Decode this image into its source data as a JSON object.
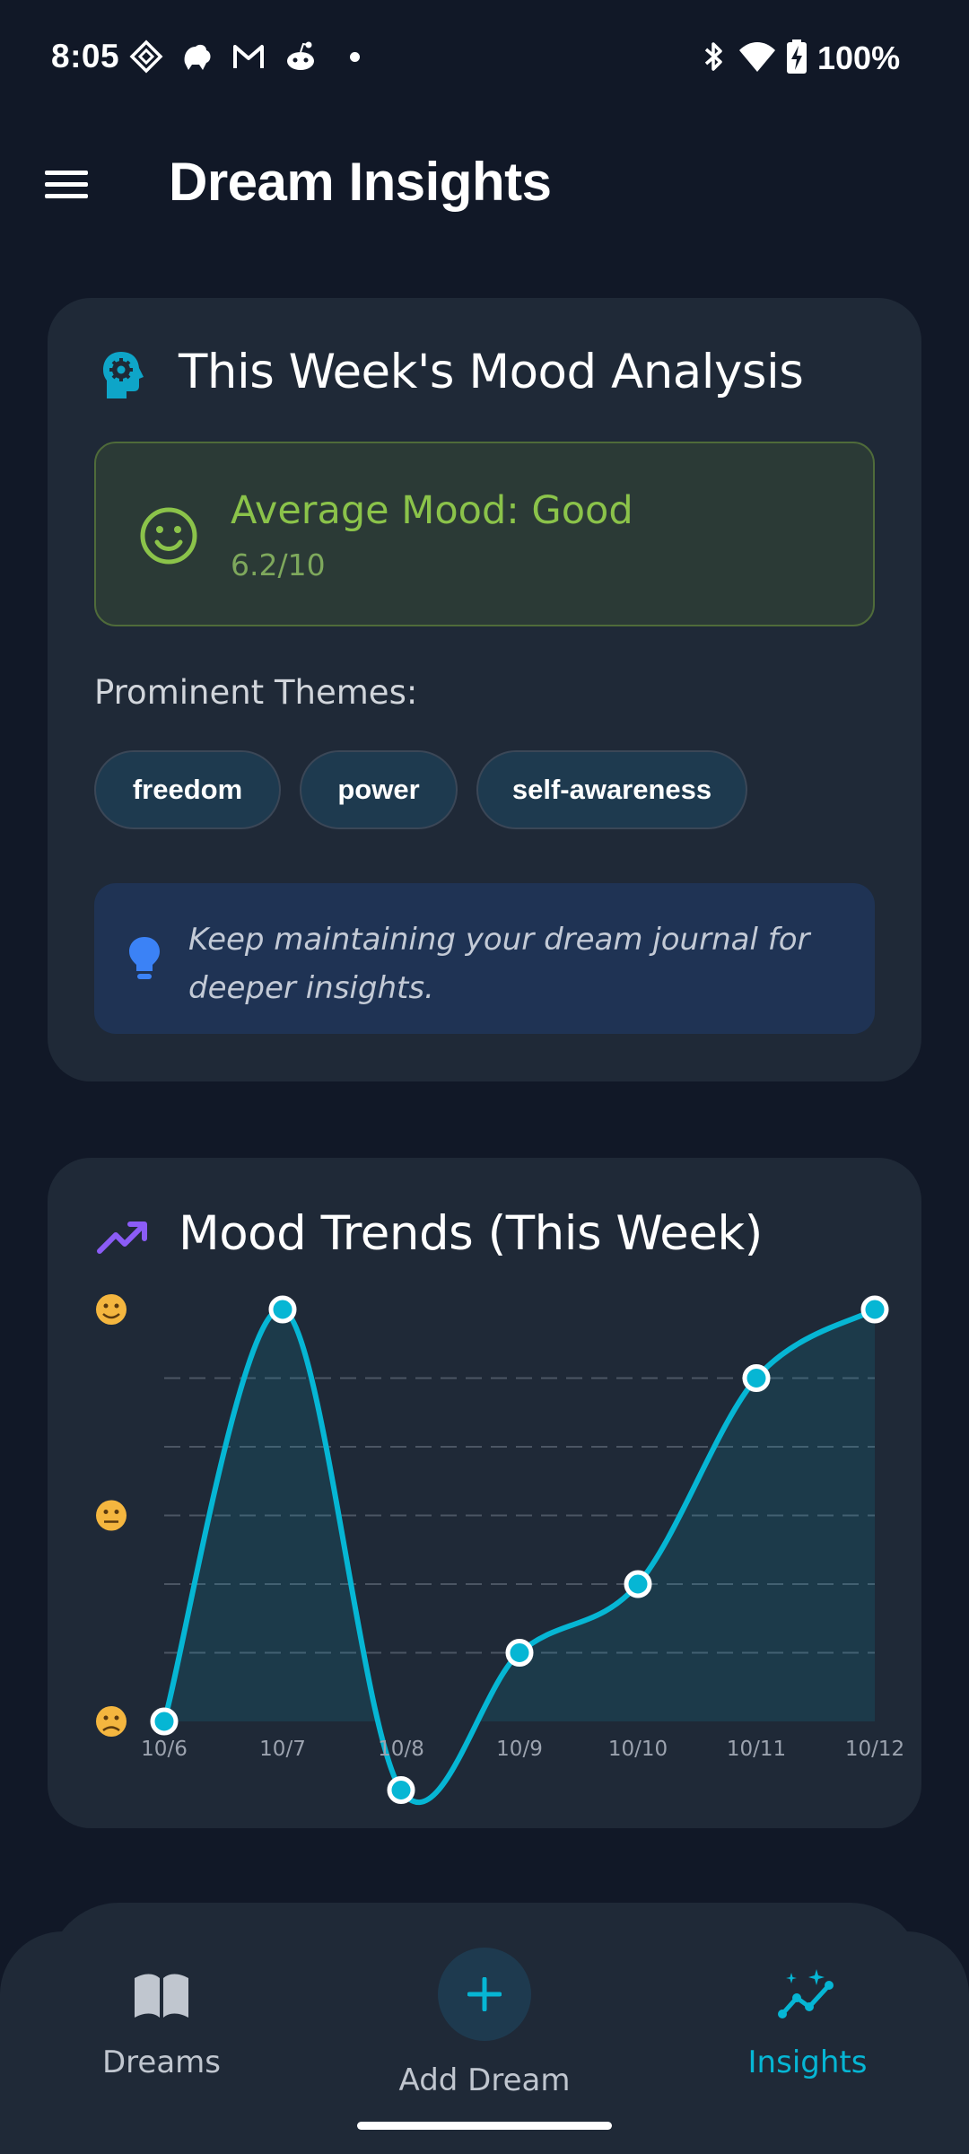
{
  "status_bar": {
    "time": "8:05",
    "battery_percent": "100%"
  },
  "app_bar": {
    "title": "Dream Insights",
    "menu_icon": "hamburger-menu-icon"
  },
  "mood_card": {
    "title": "This Week's Mood Analysis",
    "icon": "head-gear-icon",
    "average_mood": {
      "label": "Average Mood: Good",
      "score": "6.2/10",
      "icon": "smiley-face-icon",
      "color": "#8bc34a"
    },
    "themes_label": "Prominent Themes:",
    "themes": [
      "freedom",
      "power",
      "self-awareness"
    ],
    "tip": {
      "icon": "lightbulb-icon",
      "text": "Keep maintaining your dream journal for deeper insights."
    }
  },
  "trend_card": {
    "title": "Mood Trends (This Week)",
    "icon": "trending-up-icon",
    "accent_color": "#06b6d4"
  },
  "chart_data": {
    "type": "line",
    "categories": [
      "10/6",
      "10/7",
      "10/8",
      "10/9",
      "10/10",
      "10/11",
      "10/12"
    ],
    "values": [
      0,
      6,
      -1,
      1,
      2,
      5,
      6
    ],
    "y_axis_markers": [
      "😊",
      "😐",
      "😢"
    ],
    "ylim": [
      0,
      6
    ],
    "grid": true,
    "area_fill": true,
    "smooth": true
  },
  "bottom_nav": {
    "items": [
      {
        "label": "Dreams",
        "icon": "open-book-icon",
        "active": false
      },
      {
        "label": "Add Dream",
        "icon": "plus-icon",
        "active": false
      },
      {
        "label": "Insights",
        "icon": "sparkle-chart-icon",
        "active": true
      }
    ],
    "active_color": "#06b6d4"
  }
}
